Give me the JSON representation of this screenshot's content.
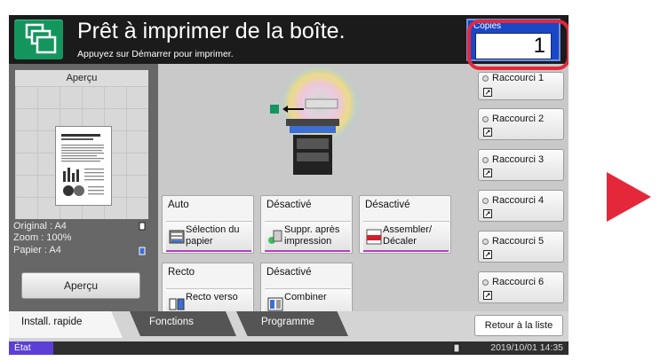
{
  "header": {
    "title": "Prêt à imprimer de la boîte.",
    "subtitle": "Appuyez sur Démarrer pour imprimer."
  },
  "copies": {
    "label": "Copies",
    "value": "1"
  },
  "preview": {
    "caption": "Aperçu",
    "original": "Original  : A4",
    "zoom": "Zoom      : 100%",
    "paper": "Papier     : A4",
    "button": "Aperçu"
  },
  "options": [
    {
      "value": "Auto",
      "label": "Sélection du papier"
    },
    {
      "value": "Désactivé",
      "label": "Suppr. après impression"
    },
    {
      "value": "Désactivé",
      "label": "Assembler/ Décaler"
    },
    {
      "value": "Recto",
      "label": "Recto verso"
    },
    {
      "value": "Désactivé",
      "label": "Combiner"
    }
  ],
  "shortcuts": [
    "Raccourci 1",
    "Raccourci 2",
    "Raccourci 3",
    "Raccourci 4",
    "Raccourci 5",
    "Raccourci 6"
  ],
  "tabs": {
    "install": "Install. rapide",
    "functions": "Fonctions",
    "program": "Programme"
  },
  "retour": "Retour à la liste",
  "status": {
    "state": "État",
    "datetime": "2019/10/01 14:35"
  },
  "colors": {
    "accent": "#e5273a",
    "home": "#14955e",
    "copies_bg": "#1a47c4",
    "status": "#5c3fd6"
  }
}
